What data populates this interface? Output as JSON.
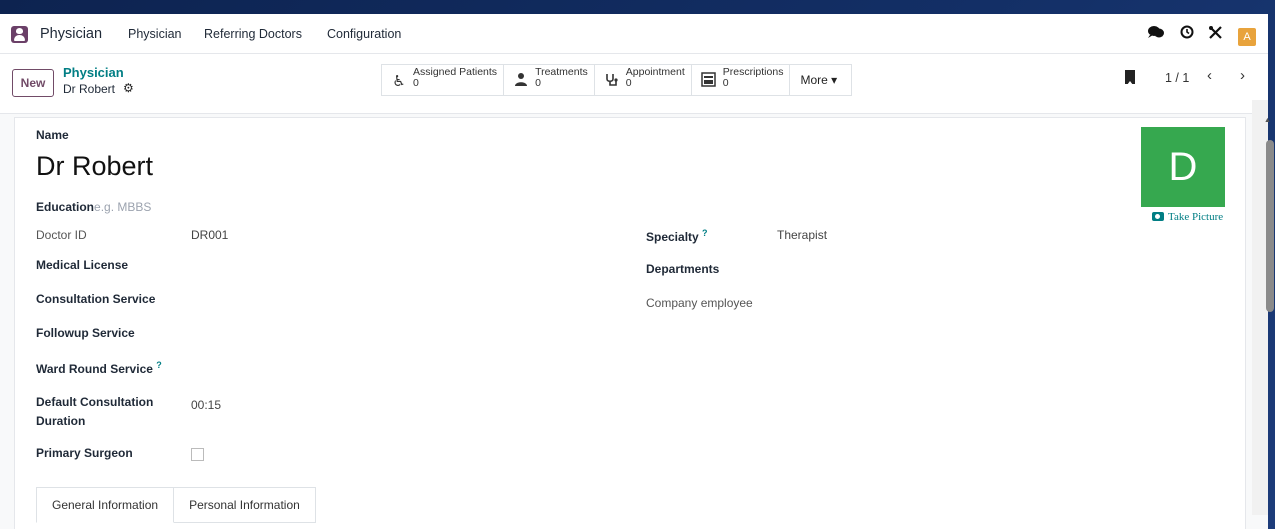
{
  "navbar": {
    "brand": "Physician",
    "menu": [
      "Physician",
      "Referring Doctors",
      "Configuration"
    ],
    "avatar_letter": "A",
    "icons": [
      "chat-icon",
      "clock-icon",
      "tools-icon"
    ]
  },
  "control": {
    "new_label": "New",
    "breadcrumb_parent": "Physician",
    "breadcrumb_current": "Dr Robert",
    "smart_buttons": [
      {
        "label": "Assigned Patients",
        "count": "0",
        "icon": "wheelchair-icon"
      },
      {
        "label": "Treatments",
        "count": "0",
        "icon": "users-icon"
      },
      {
        "label": "Appointment",
        "count": "0",
        "icon": "stethoscope-icon"
      },
      {
        "label": "Prescriptions",
        "count": "0",
        "icon": "prescription-icon"
      }
    ],
    "more_label": "More ▾",
    "pager": "1 / 1"
  },
  "form": {
    "name_label": "Name",
    "name_value": "Dr Robert",
    "education_label": "Education",
    "education_placeholder": "e.g. MBBS",
    "doctor_id_label": "Doctor ID",
    "doctor_id_value": "DR001",
    "medical_license_label": "Medical License",
    "consultation_service_label": "Consultation Service",
    "followup_service_label": "Followup Service",
    "ward_round_label": "Ward Round Service",
    "default_duration_label_1": "Default Consultation",
    "default_duration_label_2": "Duration",
    "default_duration_value": "00:15",
    "primary_surgeon_label": "Primary Surgeon",
    "specialty_label": "Specialty",
    "specialty_value": "Therapist",
    "departments_label": "Departments",
    "company_employee_label": "Company employee",
    "help_mark": "?",
    "avatar_letter": "D",
    "take_picture": "Take Picture"
  },
  "tabs": [
    "General Information",
    "Personal Information"
  ],
  "colors": {
    "brand": "#714b67",
    "link": "#017e84",
    "avatar_bg": "#36a84f",
    "user_avatar": "#e8a33c"
  }
}
